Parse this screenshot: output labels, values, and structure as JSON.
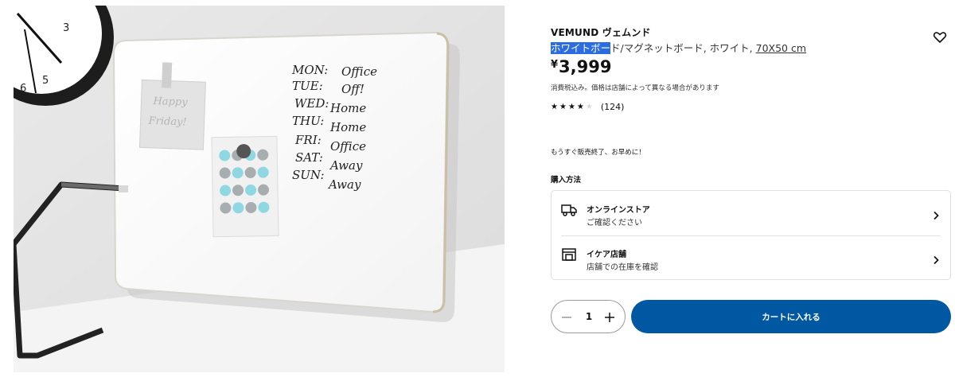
{
  "product": {
    "name": "VEMUND ヴェムンド",
    "desc_selected": "ホワイトボー",
    "desc_rest": "ド/マグネットボード, ホワイト, ",
    "size_link": "70X50 cm",
    "price_currency": "¥",
    "price_value": "3,999",
    "tax_note": "消費税込み。価格は店舗によって異なる場合があります",
    "rating_stars": 4,
    "rating_max": 5,
    "rating_count": "(124)",
    "notice": "もうすぐ販売終了、お早めに！"
  },
  "image": {
    "board_notes": {
      "days": [
        "MON:",
        "TUE:",
        "WED:",
        "THU:",
        "FRI:",
        "SAT:",
        "SUN:"
      ],
      "plans": [
        "Office",
        "Off!",
        "Home",
        "Home",
        "Office",
        "Away",
        "Away"
      ],
      "sticky_note": [
        "Happy",
        "Friday!"
      ]
    },
    "clock_numbers": [
      "3",
      "5",
      "6"
    ]
  },
  "purchase": {
    "heading": "購入方法",
    "options": [
      {
        "title": "オンラインストア",
        "subtitle": "ご確認ください",
        "icon": "delivery-truck-icon"
      },
      {
        "title": "イケア店舗",
        "subtitle": "店舗での在庫を確認",
        "icon": "store-icon"
      }
    ]
  },
  "cart": {
    "quantity": "1",
    "add_label": "カートに入れる"
  },
  "colors": {
    "primary_button": "#0058a3",
    "selection": "#2b6de0"
  }
}
